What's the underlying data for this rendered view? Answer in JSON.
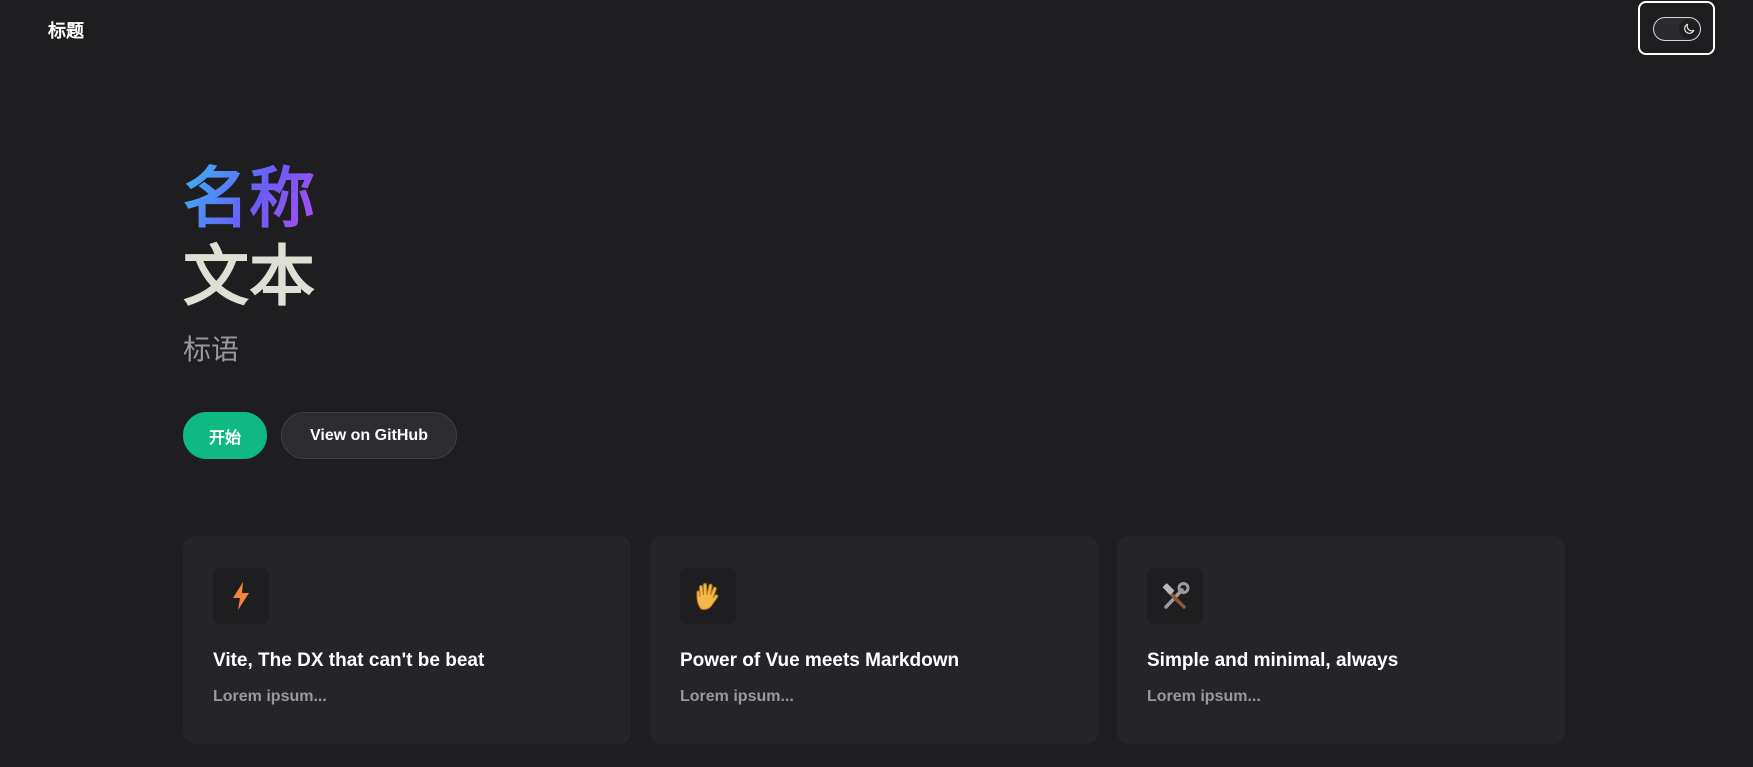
{
  "nav": {
    "title": "标题"
  },
  "theme_toggle": {
    "icon": "moon-icon"
  },
  "hero": {
    "name": "名称",
    "text": "文本",
    "tagline": "标语"
  },
  "actions": [
    {
      "label": "开始",
      "theme": "brand"
    },
    {
      "label": "View on GitHub",
      "theme": "alt"
    }
  ],
  "features": [
    {
      "icon": "lightning-icon",
      "glyph": "⚡",
      "title": "Vite, The DX that can't be beat",
      "details": "Lorem ipsum..."
    },
    {
      "icon": "vulcan-salute-icon",
      "glyph": "🖖",
      "title": "Power of Vue meets Markdown",
      "details": "Lorem ipsum..."
    },
    {
      "icon": "hammer-wrench-icon",
      "glyph": "🛠",
      "title": "Simple and minimal, always",
      "details": "Lorem ipsum..."
    }
  ],
  "colors": {
    "background": "#1e1e20",
    "brand": "#10b981",
    "card": "#252529",
    "muted": "#98989f"
  }
}
